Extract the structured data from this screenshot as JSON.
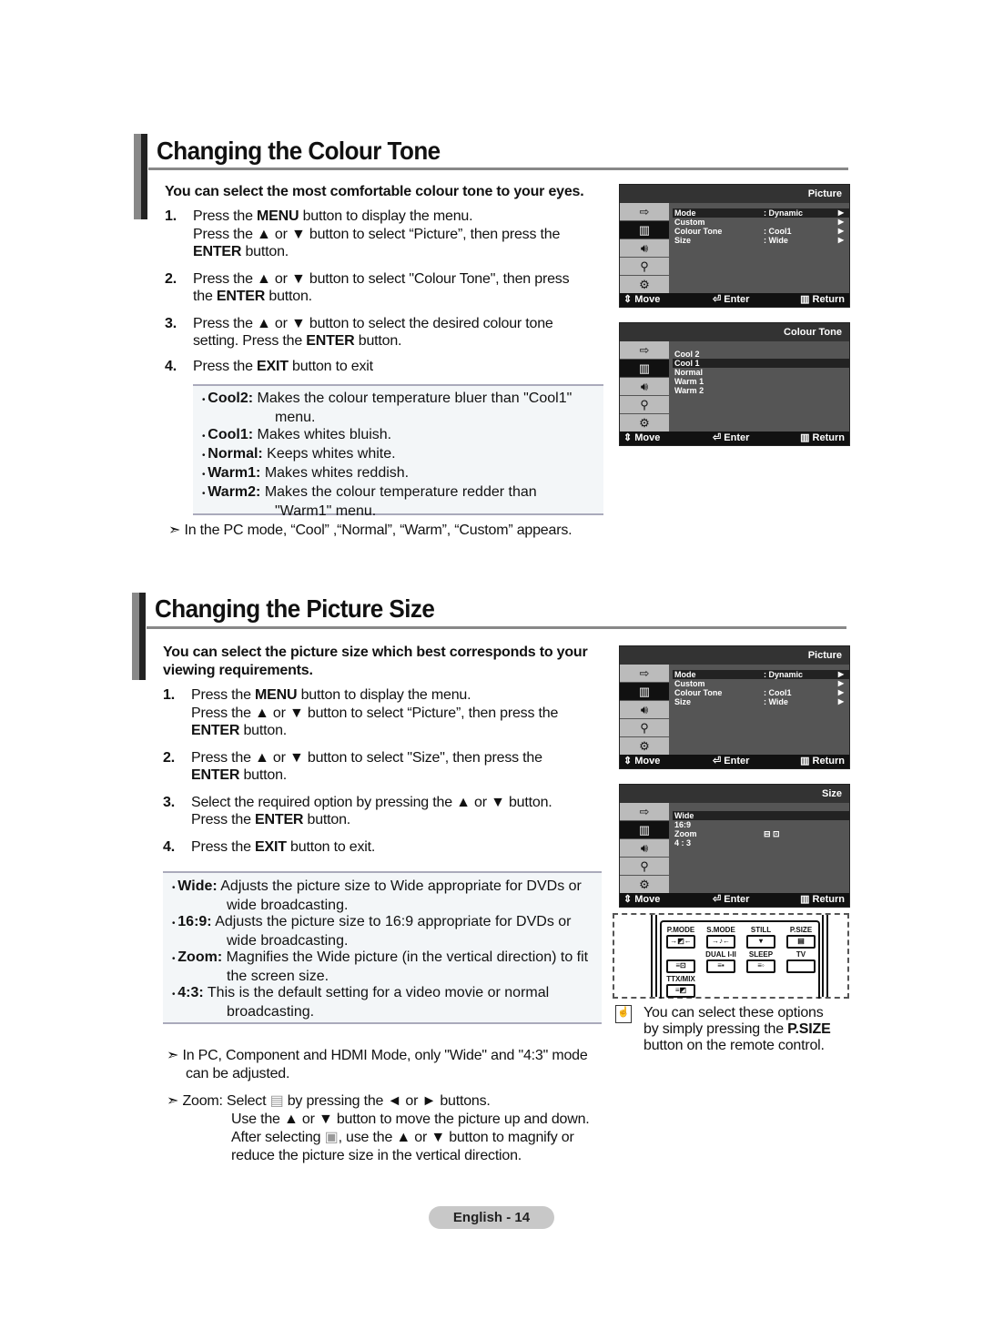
{
  "section1": {
    "title": "Changing the Colour Tone",
    "subtitle": "You can select the most comfortable colour tone to your eyes.",
    "steps": [
      {
        "num": "1.",
        "lines": [
          [
            {
              "t": "Press the "
            },
            {
              "t": "MENU",
              "b": 1
            },
            {
              "t": " button to display the menu."
            }
          ],
          [
            {
              "t": "Press the ▲ or ▼ button to select “Picture”, then press the"
            }
          ],
          [
            {
              "t": "ENTER",
              "b": 1
            },
            {
              "t": " button."
            }
          ]
        ]
      },
      {
        "num": "2.",
        "lines": [
          [
            {
              "t": "Press the ▲ or ▼ button to select \"Colour Tone\", then press"
            }
          ],
          [
            {
              "t": "the "
            },
            {
              "t": "ENTER",
              "b": 1
            },
            {
              "t": " button."
            }
          ]
        ]
      },
      {
        "num": "3.",
        "lines": [
          [
            {
              "t": "Press the ▲ or ▼ button to select the desired colour tone"
            }
          ],
          [
            {
              "t": "setting. Press the "
            },
            {
              "t": "ENTER",
              "b": 1
            },
            {
              "t": " button."
            }
          ]
        ]
      },
      {
        "num": "4.",
        "lines": [
          [
            {
              "t": "Press the "
            },
            {
              "t": "EXIT",
              "b": 1
            },
            {
              "t": " button to exit"
            }
          ]
        ]
      }
    ],
    "options": [
      {
        "key": "Cool2:",
        "desc": "Makes the colour temperature bluer than \"Cool1\"",
        "cont": "menu."
      },
      {
        "key": "Cool1:",
        "desc": "Makes whites bluish."
      },
      {
        "key": "Normal:",
        "desc": "Keeps whites white."
      },
      {
        "key": "Warm1:",
        "desc": "Makes whites reddish."
      },
      {
        "key": "Warm2:",
        "desc": "Makes the colour temperature redder than",
        "cont": "\"Warm1\" menu."
      }
    ],
    "note": "In the PC mode, “Cool” ,“Normal”, “Warm”, “Custom” appears."
  },
  "section2": {
    "title": "Changing the Picture Size",
    "subtitle_lines": [
      "You can select the picture size which best corresponds to your",
      "viewing requirements."
    ],
    "steps": [
      {
        "num": "1.",
        "lines": [
          [
            {
              "t": "Press the "
            },
            {
              "t": "MENU",
              "b": 1
            },
            {
              "t": " button to display the menu."
            }
          ],
          [
            {
              "t": "Press the ▲ or ▼ button to select “Picture”, then press the"
            }
          ],
          [
            {
              "t": "ENTER",
              "b": 1
            },
            {
              "t": " button."
            }
          ]
        ]
      },
      {
        "num": "2.",
        "lines": [
          [
            {
              "t": "Press the ▲ or ▼ button to select \"Size\", then press the"
            }
          ],
          [
            {
              "t": "ENTER",
              "b": 1
            },
            {
              "t": " button."
            }
          ]
        ]
      },
      {
        "num": "3.",
        "lines": [
          [
            {
              "t": "Select the required option by pressing the ▲ or ▼ button."
            }
          ],
          [
            {
              "t": "Press the "
            },
            {
              "t": "ENTER",
              "b": 1
            },
            {
              "t": " button."
            }
          ]
        ]
      },
      {
        "num": "4.",
        "lines": [
          [
            {
              "t": "Press the "
            },
            {
              "t": "EXIT",
              "b": 1
            },
            {
              "t": " button to exit."
            }
          ]
        ]
      }
    ],
    "options": [
      {
        "key": "Wide:",
        "desc": "Adjusts the picture size to Wide appropriate for DVDs or",
        "cont": "wide broadcasting."
      },
      {
        "key": "16:9:",
        "desc": "Adjusts the picture size to 16:9 appropriate for DVDs or",
        "cont": "wide broadcasting."
      },
      {
        "key": "Zoom:",
        "desc": "Magnifies the Wide picture (in the vertical direction) to fit",
        "cont": "the screen size."
      },
      {
        "key": "4:3:",
        "desc": "This is the default setting for a video movie or normal",
        "cont": "broadcasting."
      }
    ],
    "note1_lines": [
      "In PC, Component and HDMI Mode, only \"Wide\" and \"4:3\" mode",
      "can be adjusted."
    ],
    "note2": {
      "lead": "Zoom: Select",
      "l1_rest": "by pressing the ◄ or ► buttons.",
      "l2": "Use the ▲ or ▼ button to move the picture up and down.",
      "l3a": "After selecting",
      "l3b": ", use the ▲ or ▼ button to magnify or",
      "l4": "reduce the picture size in the vertical direction."
    },
    "remote_note": [
      [
        {
          "t": "You can select these options"
        }
      ],
      [
        {
          "t": "by simply pressing the "
        },
        {
          "t": "P.SIZE",
          "b": 1
        }
      ],
      [
        {
          "t": "button on the remote control."
        }
      ]
    ]
  },
  "osd": [
    {
      "header": "Picture",
      "selected": 0,
      "rows": [
        {
          "label": "Mode",
          "value": ": Dynamic",
          "arrow": "▶"
        },
        {
          "label": "Custom",
          "value": "",
          "arrow": "▶"
        },
        {
          "label": "Colour Tone",
          "value": ": Cool1",
          "arrow": "▶"
        },
        {
          "label": "Size",
          "value": ": Wide",
          "arrow": "▶"
        }
      ]
    },
    {
      "header": "Colour Tone",
      "selected": 1,
      "rows": [
        {
          "label": "Cool 2"
        },
        {
          "label": "Cool 1"
        },
        {
          "label": "Normal"
        },
        {
          "label": "Warm 1"
        },
        {
          "label": "Warm 2"
        }
      ]
    },
    {
      "header": "Picture",
      "selected": 0,
      "rows": [
        {
          "label": "Mode",
          "value": ": Dynamic",
          "arrow": "▶"
        },
        {
          "label": "Custom",
          "value": "",
          "arrow": "▶"
        },
        {
          "label": "Colour Tone",
          "value": ": Cool1",
          "arrow": "▶"
        },
        {
          "label": "Size",
          "value": ": Wide",
          "arrow": "▶"
        }
      ]
    },
    {
      "header": "Size",
      "selected": 0,
      "rows": [
        {
          "label": "Wide"
        },
        {
          "label": "16:9"
        },
        {
          "label": "Zoom",
          "value": "⊟   ⊡"
        },
        {
          "label": "4 : 3"
        }
      ]
    }
  ],
  "osd_footer": {
    "move": "Move",
    "enter": "Enter",
    "return": "Return"
  },
  "osd_icons": [
    "input-icon",
    "picture-icon",
    "sound-icon",
    "channel-icon",
    "setup-icon"
  ],
  "remote": {
    "buttons": [
      {
        "label": "P.MODE",
        "key": "→◩←"
      },
      {
        "label": "S.MODE",
        "key": "→♪←"
      },
      {
        "label": "STILL",
        "key": "▾"
      },
      {
        "label": "P.SIZE",
        "key": "▤"
      },
      {
        "label": "",
        "key": "≡⊡"
      },
      {
        "label": "DUAL I-II",
        "key": "≡▪"
      },
      {
        "label": "SLEEP",
        "key": "≡◦"
      },
      {
        "label": "TV",
        "key": ""
      },
      {
        "label": "TTX/MIX",
        "key": "≡◩"
      }
    ]
  },
  "footer": {
    "page_label": "English - 14"
  }
}
